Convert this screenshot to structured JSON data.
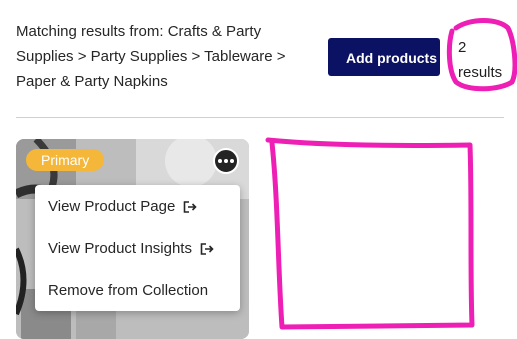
{
  "header": {
    "matching_text": "Matching results from: Crafts & Party Supplies > Party Supplies > Tableware > Paper & Party Napkins",
    "add_products_label": "Add products",
    "results_count": "2 results"
  },
  "card": {
    "badge": "Primary",
    "menu_items": [
      {
        "label": "View Product Page",
        "icon": "external-link-icon"
      },
      {
        "label": "View Product Insights",
        "icon": "external-link-icon"
      },
      {
        "label": "Remove from Collection",
        "icon": null
      }
    ]
  },
  "colors": {
    "add_button_bg": "#0c1263",
    "badge_bg": "#f4b73a",
    "annotation_marker": "#ee1fb4"
  }
}
